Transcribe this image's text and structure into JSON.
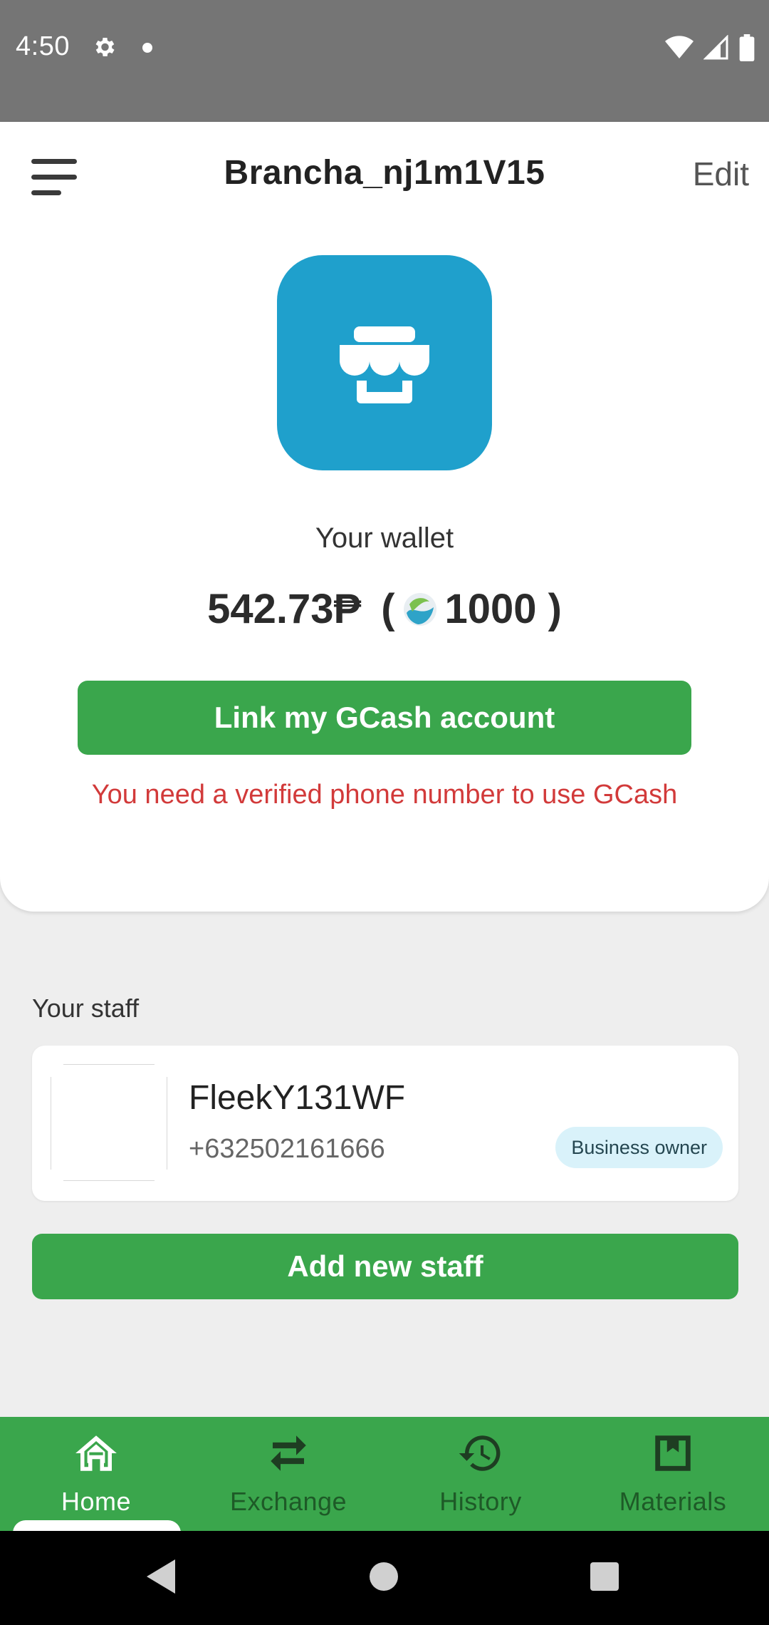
{
  "status_bar": {
    "time": "4:50",
    "icons": [
      "gear-icon",
      "notification-dot-icon",
      "wifi-icon",
      "signal-icon",
      "battery-icon"
    ]
  },
  "header": {
    "title": "Brancha_nj1m1V15",
    "edit_label": "Edit"
  },
  "wallet": {
    "label": "Your wallet",
    "balance": "542.73₱",
    "open_paren": "(",
    "points": "1000",
    "close_paren": ")"
  },
  "gcash": {
    "button_label": "Link my GCash account",
    "warning": "You need a verified phone number to use GCash"
  },
  "staff": {
    "section_label": "Your staff",
    "members": [
      {
        "name": "FleekY131WF",
        "phone": "+632502161666",
        "role": "Business owner"
      }
    ],
    "add_button_label": "Add new staff"
  },
  "bottom_nav": {
    "items": [
      {
        "label": "Home",
        "icon": "home-icon",
        "active": true
      },
      {
        "label": "Exchange",
        "icon": "exchange-icon",
        "active": false
      },
      {
        "label": "History",
        "icon": "history-icon",
        "active": false
      },
      {
        "label": "Materials",
        "icon": "materials-icon",
        "active": false
      }
    ]
  },
  "colors": {
    "primary_green": "#3aa64c",
    "logo_blue": "#1fa0cc",
    "warning_red": "#d23a3a",
    "badge_bg": "#d9f2fa"
  }
}
